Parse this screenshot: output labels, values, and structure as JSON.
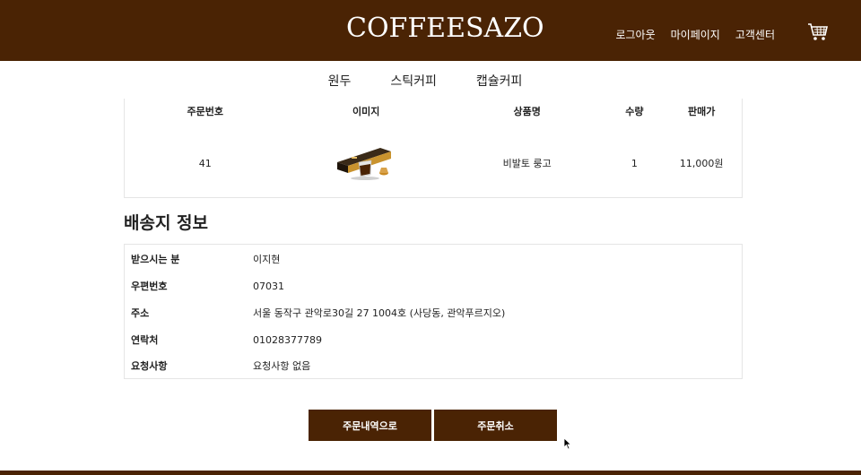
{
  "header": {
    "logo": "COFFEESAZO",
    "links": [
      "로그아웃",
      "마이페이지",
      "고객센터"
    ],
    "cart_icon": "cart-icon",
    "bg_color": "#4a2304"
  },
  "categories": [
    "원두",
    "스틱커피",
    "캡슐커피"
  ],
  "order": {
    "columns": [
      "주문번호",
      "이미지",
      "상품명",
      "수량",
      "판매가"
    ],
    "rows": [
      {
        "order_no": "41",
        "image": "capsule-box-image",
        "product_name": "비발토 룽고",
        "quantity": "1",
        "price": "11,000원"
      }
    ]
  },
  "shipping": {
    "title": "배송지 정보",
    "rows": [
      {
        "label": "받으시는 분",
        "value": "이지현"
      },
      {
        "label": "우편번호",
        "value": "07031"
      },
      {
        "label": "주소",
        "value": "서울 동작구 관악로30길 27 1004호 (사당동, 관악푸르지오)"
      },
      {
        "label": "연락처",
        "value": "01028377789"
      },
      {
        "label": "요청사항",
        "value": "요청사항 없음"
      }
    ]
  },
  "buttons": {
    "history": "주문내역으로",
    "cancel": "주문취소"
  }
}
